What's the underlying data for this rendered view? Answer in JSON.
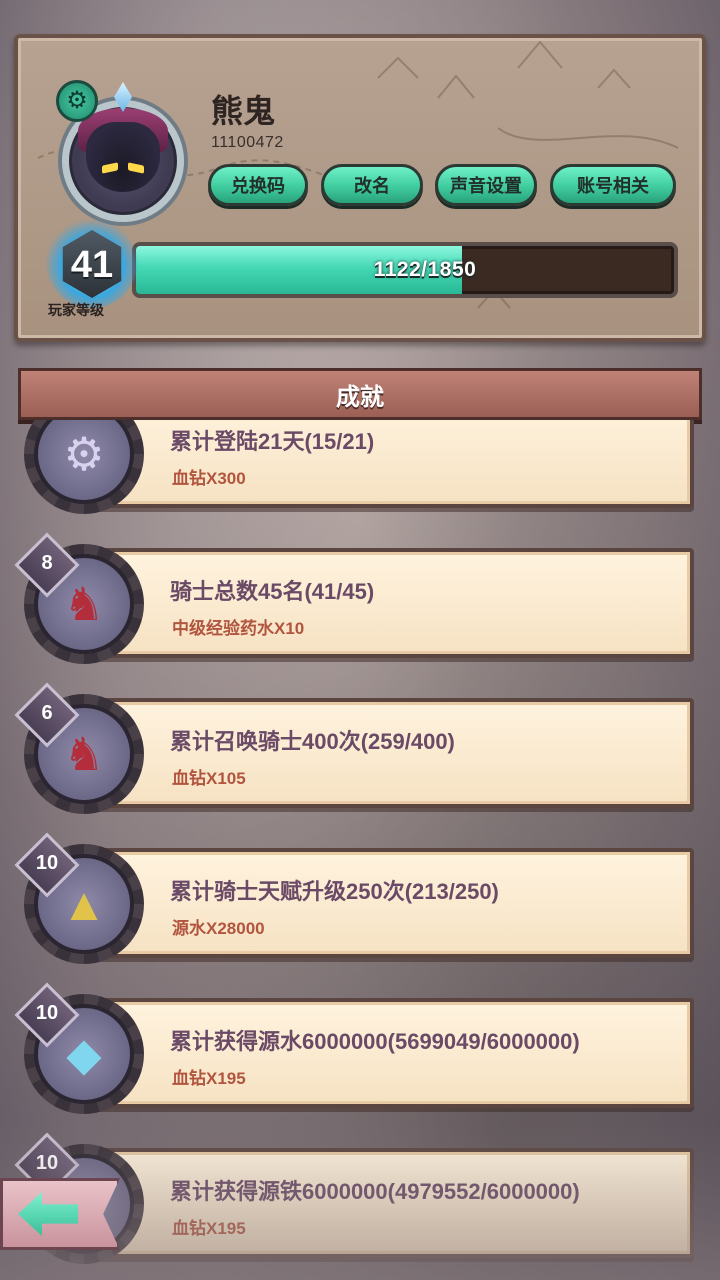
{
  "profile": {
    "name": "熊鬼",
    "id": "11100472",
    "level": "41",
    "level_label": "玩家等级",
    "xp_text": "1122/1850",
    "xp_progress": 0.606,
    "buttons": {
      "redeem": "兑换码",
      "rename": "改名",
      "sound": "声音设置",
      "account": "账号相关"
    }
  },
  "section_title": "成就",
  "achievements": [
    {
      "title": "累计登陆21天(15/21)",
      "reward": "血钻X300",
      "tier": "",
      "icon": "gear-emblem-icon"
    },
    {
      "title": "骑士总数45名(41/45)",
      "reward": "中级经验药水X10",
      "tier": "8",
      "icon": "knights-group-icon"
    },
    {
      "title": "累计召唤骑士400次(259/400)",
      "reward": "血钻X105",
      "tier": "6",
      "icon": "knights-group-icon"
    },
    {
      "title": "累计骑士天赋升级250次(213/250)",
      "reward": "源水X28000",
      "tier": "10",
      "icon": "knight-hat-icon"
    },
    {
      "title": "累计获得源水6000000(5699049/6000000)",
      "reward": "血钻X195",
      "tier": "10",
      "icon": "crystal-ore-icon"
    },
    {
      "title": "累计获得源铁6000000(4979552/6000000)",
      "reward": "血钻X195",
      "tier": "10",
      "icon": "blue-flame-icon"
    }
  ],
  "colors": {
    "accent_green": "#44d8b5",
    "title_purple": "#6a4a66",
    "reward_red": "#b1553f",
    "header_rose": "#9b5f55"
  }
}
